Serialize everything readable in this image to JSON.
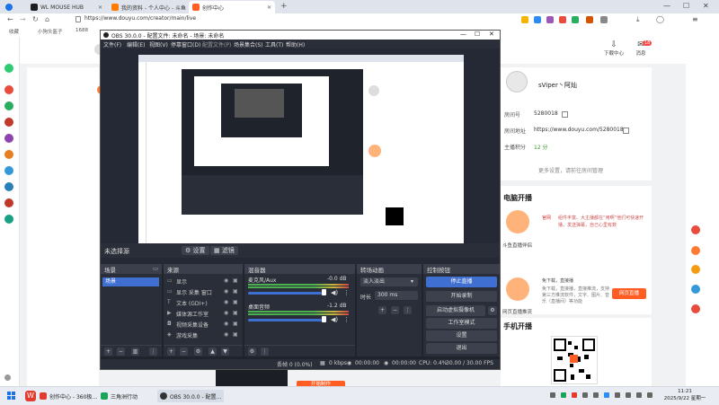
{
  "browser": {
    "tabs": [
      {
        "title": "WL MOUSE HUB",
        "color": "#1e1e1e"
      },
      {
        "title": "我的资料 - 个人中心 - 斗鱼",
        "color": "#ff7a00"
      },
      {
        "title": "创作中心",
        "color": "#ff5d23"
      }
    ],
    "url": "https://www.douyu.com/creator/main/live",
    "bookmarks": [
      "收藏",
      "小狗头盔子",
      "1688"
    ]
  },
  "header": {
    "nav_icons": [
      {
        "label": "下载中心",
        "icon": "download-icon"
      },
      {
        "label": "消息",
        "icon": "message-icon",
        "badge": "18"
      }
    ]
  },
  "profile": {
    "name": "sViper丶阿灿",
    "room_label": "房间号",
    "room_value": "5280018",
    "room_url_label": "房间地址",
    "room_url_value": "https://www.douyu.com/5280018",
    "points_label": "主播积分",
    "points_value": "12 分",
    "more_link": "更多设置，请前往房间管理"
  },
  "pc_live": {
    "title": "电脑开播",
    "tool_name": "斗鱼直播伴侣",
    "tool_badge": "官网",
    "tool_desc": "组件丰富、大主播都在“用啊”他们可快速开播，发送弹幕，自己心里有数",
    "obs_name": "网页直播推流",
    "obs_desc": "免下载，直接播，直接推流，支持第三方推流软件，文字、图片、音乐（直播间）等功能",
    "obs_button": "网页直播",
    "obs_hint": "免下载，直接播"
  },
  "mobile_live": {
    "title": "手机开播",
    "start_button": "开始制作"
  },
  "obs": {
    "title": "OBS 30.0.0 - 配置文件: 未命名 - 场景: 未命名",
    "menu": [
      "文件(F)",
      "编辑(E)",
      "视图(V)",
      "停靠窗口(D)",
      "配置文件(P)",
      "场景集合(S)",
      "工具(T)",
      "帮助(H)"
    ],
    "source_bar": {
      "no_source": "未选择源",
      "props": "设置",
      "filters": "滤镜"
    },
    "docks": {
      "scenes": {
        "title": "场景",
        "items": [
          "场景"
        ]
      },
      "sources": {
        "title": "来源",
        "items": [
          "显示",
          "显示 采集 窗口",
          "文本 (GDI+)",
          "媒体源工作室",
          "视频采集设备",
          "游戏采集"
        ]
      },
      "mixer": {
        "title": "混音器",
        "channels": [
          {
            "name": "麦克风/Aux",
            "db": "-0.0 dB"
          },
          {
            "name": "桌面音频",
            "db": "-1.2 dB"
          }
        ]
      },
      "transitions": {
        "title": "转场动画",
        "type": "淡入淡出",
        "duration_label": "时长",
        "duration_value": "300 ms"
      },
      "controls": {
        "title": "控制按钮",
        "buttons": [
          "停止直播",
          "开始录制",
          "启动虚拟摄像机",
          "工作室模式",
          "设置",
          "退出"
        ]
      }
    },
    "status": {
      "frames": "丢帧 0 (0.0%)",
      "bitrate": "0 kbps",
      "live_time": "00:00:00",
      "rec_time": "00:00:00",
      "cpu": "CPU: 0.4%",
      "fps": "30.00 / 30.00 FPS"
    }
  },
  "taskbar": {
    "apps": [
      {
        "label": "创作中心 - 360极...",
        "color": "#e23b2f"
      },
      {
        "label": "三角洲行动",
        "color": "#1aa45a"
      },
      {
        "label": "OBS 30.0.0 - 配置...",
        "color": "#333"
      }
    ],
    "time": "11:21",
    "date": "2025/9/22 星期一"
  }
}
